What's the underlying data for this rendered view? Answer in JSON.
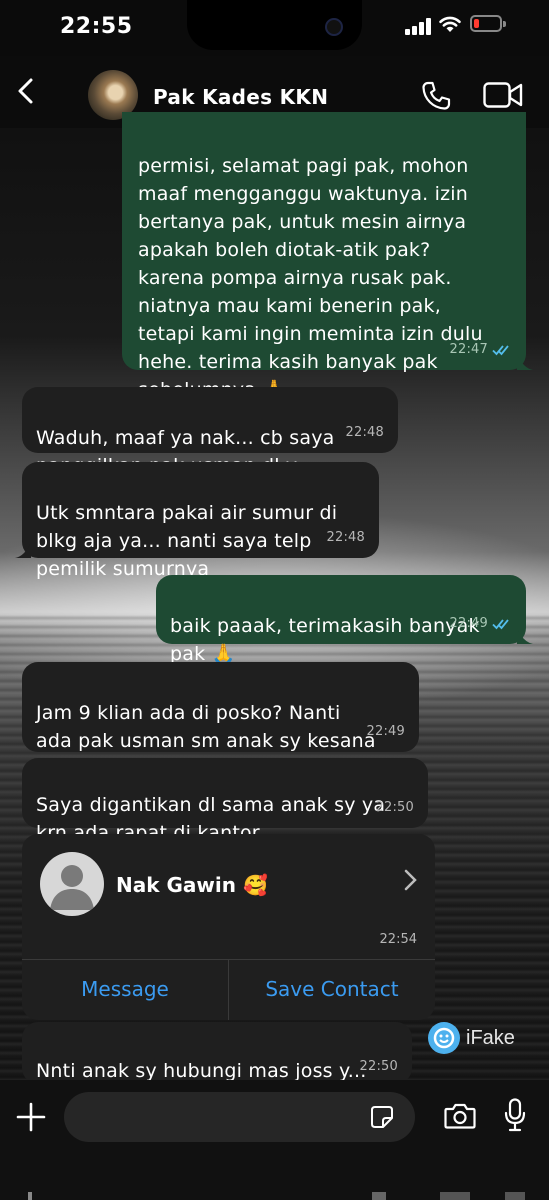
{
  "status_bar": {
    "time": "22:55"
  },
  "header": {
    "contact_name": "Pak Kades KKN"
  },
  "messages": [
    {
      "dir": "out",
      "text": "permisi, selamat pagi pak, mohon\nmaaf mengganggu waktunya. izin\nbertanya pak, untuk mesin airnya\napakah boleh diotak-atik pak?\nkarena pompa airnya rusak pak.\nniatnya mau kami benerin pak,\ntetapi kami ingin meminta izin dulu\nhehe. terima kasih banyak pak\nsebelumnya 🙏",
      "time": "22:47",
      "read": true
    },
    {
      "dir": "in",
      "text": "Waduh, maaf ya nak... cb saya\npanggilkan pak usman dl y..",
      "time": "22:48"
    },
    {
      "dir": "in",
      "text": "Utk smntara pakai air sumur di\nblkg aja ya... nanti saya telp\npemilik sumurnya",
      "time": "22:48"
    },
    {
      "dir": "out",
      "text": "baik paaak, terimakasih banyak\npak 🙏",
      "time": "22:49",
      "read": true
    },
    {
      "dir": "in",
      "text": "Jam 9 klian ada di posko? Nanti\nada pak usman sm anak sy kesana",
      "time": "22:49"
    },
    {
      "dir": "in",
      "text": "Saya digantikan dl sama anak sy ya\nkrn ada rapat di kantor...",
      "time": "22:50"
    },
    {
      "dir": "in",
      "text": "Nnti anak sy hubungi mas joss y...",
      "time": "22:50"
    }
  ],
  "contact_card": {
    "name": "Nak Gawin 🥰",
    "time": "22:54",
    "message_label": "Message",
    "save_label": "Save Contact"
  },
  "watermark": {
    "label": "iFake"
  },
  "composer": {
    "value": "",
    "placeholder": ""
  },
  "colors": {
    "outgoing_bubble": "#1e4a33",
    "incoming_bubble": "#1f1f1f",
    "link_blue": "#3b9bf0",
    "read_tick": "#53bdeb"
  },
  "icons": [
    "back-icon",
    "call-icon",
    "video-icon",
    "chevron-right-icon",
    "plus-icon",
    "sticker-icon",
    "camera-icon",
    "mic-icon",
    "read-tick-icon"
  ]
}
